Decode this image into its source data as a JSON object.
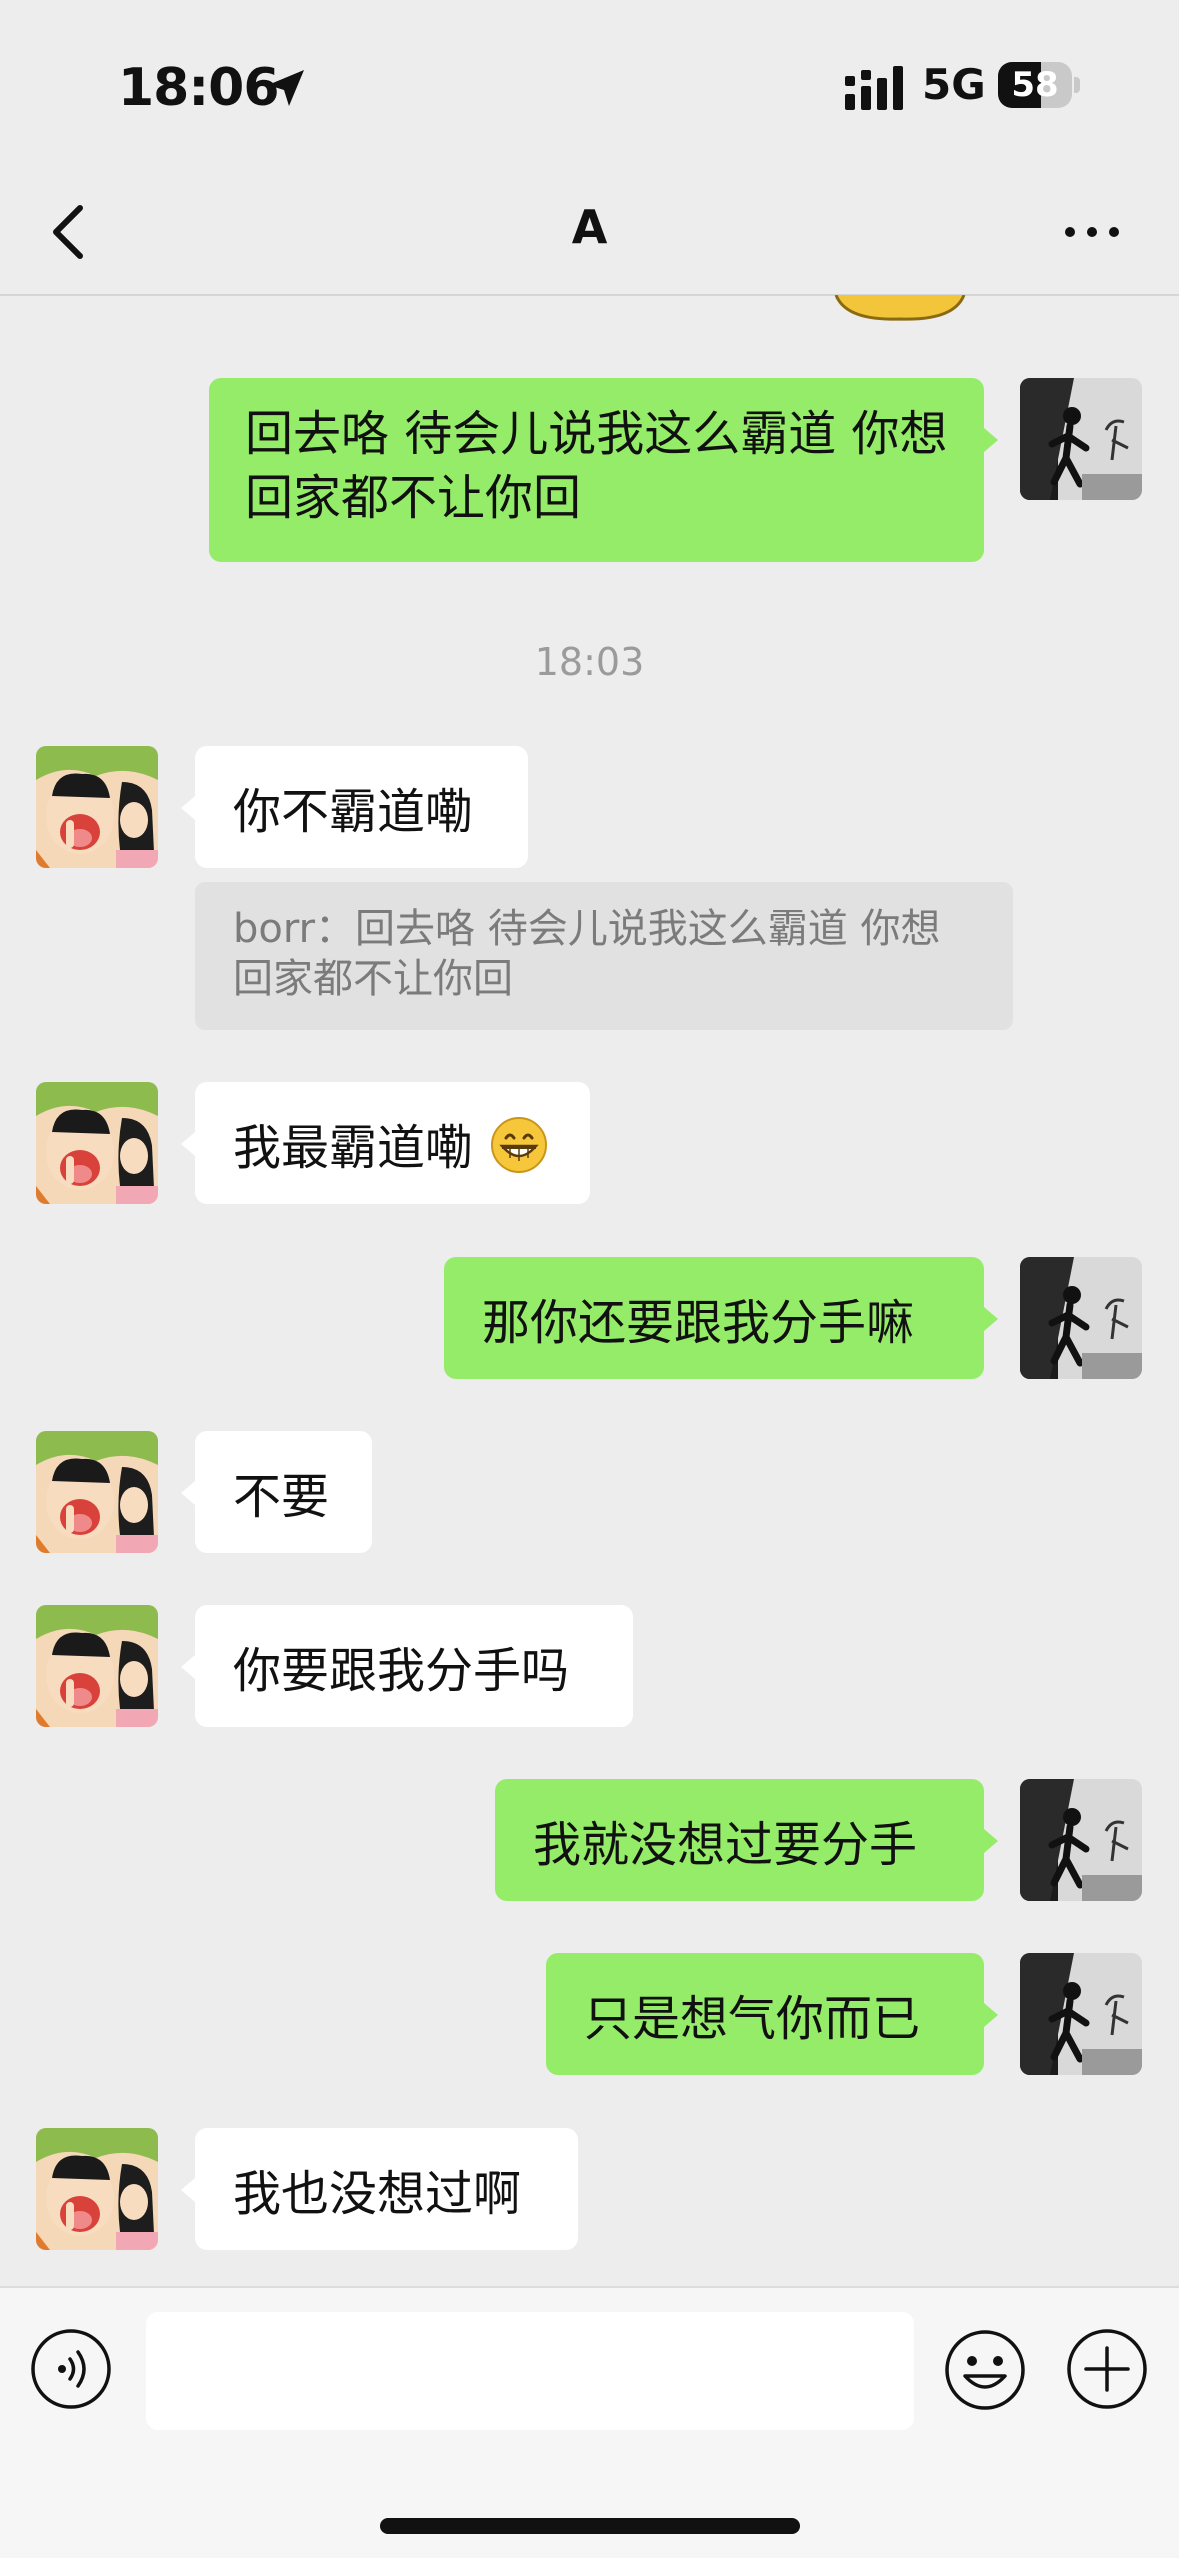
{
  "status_bar": {
    "time": "18:06",
    "network": "5G",
    "battery_level": "58",
    "battery_fraction": 0.58
  },
  "header": {
    "title": "A"
  },
  "timestamp": "18:03",
  "messages": {
    "m1": "回去咯 待会儿说我这么霸道 你想回家都不让你回",
    "m2": "你不霸道嘞",
    "m2_quote": "borr：回去咯 待会儿说我这么霸道 你想回家都不让你回",
    "m3": "我最霸道嘞",
    "m4": "那你还要跟我分手嘛",
    "m5": "不要",
    "m6": "你要跟我分手吗",
    "m7": "我就没想过要分手",
    "m8": "只是想气你而已",
    "m9": "我也没想过啊"
  },
  "colors": {
    "outgoing_bubble": "#95ec69",
    "incoming_bubble": "#ffffff",
    "background": "#ededed"
  },
  "icons": {
    "location": "location-arrow-icon",
    "signal": "cellular-signal-icon",
    "back": "chevron-left-icon",
    "more": "more-dots-icon",
    "voice": "voice-icon",
    "emoji": "emoji-smile-icon",
    "plus": "plus-circle-icon",
    "grin": "grinning-emoji-icon"
  },
  "input": {
    "placeholder": ""
  }
}
